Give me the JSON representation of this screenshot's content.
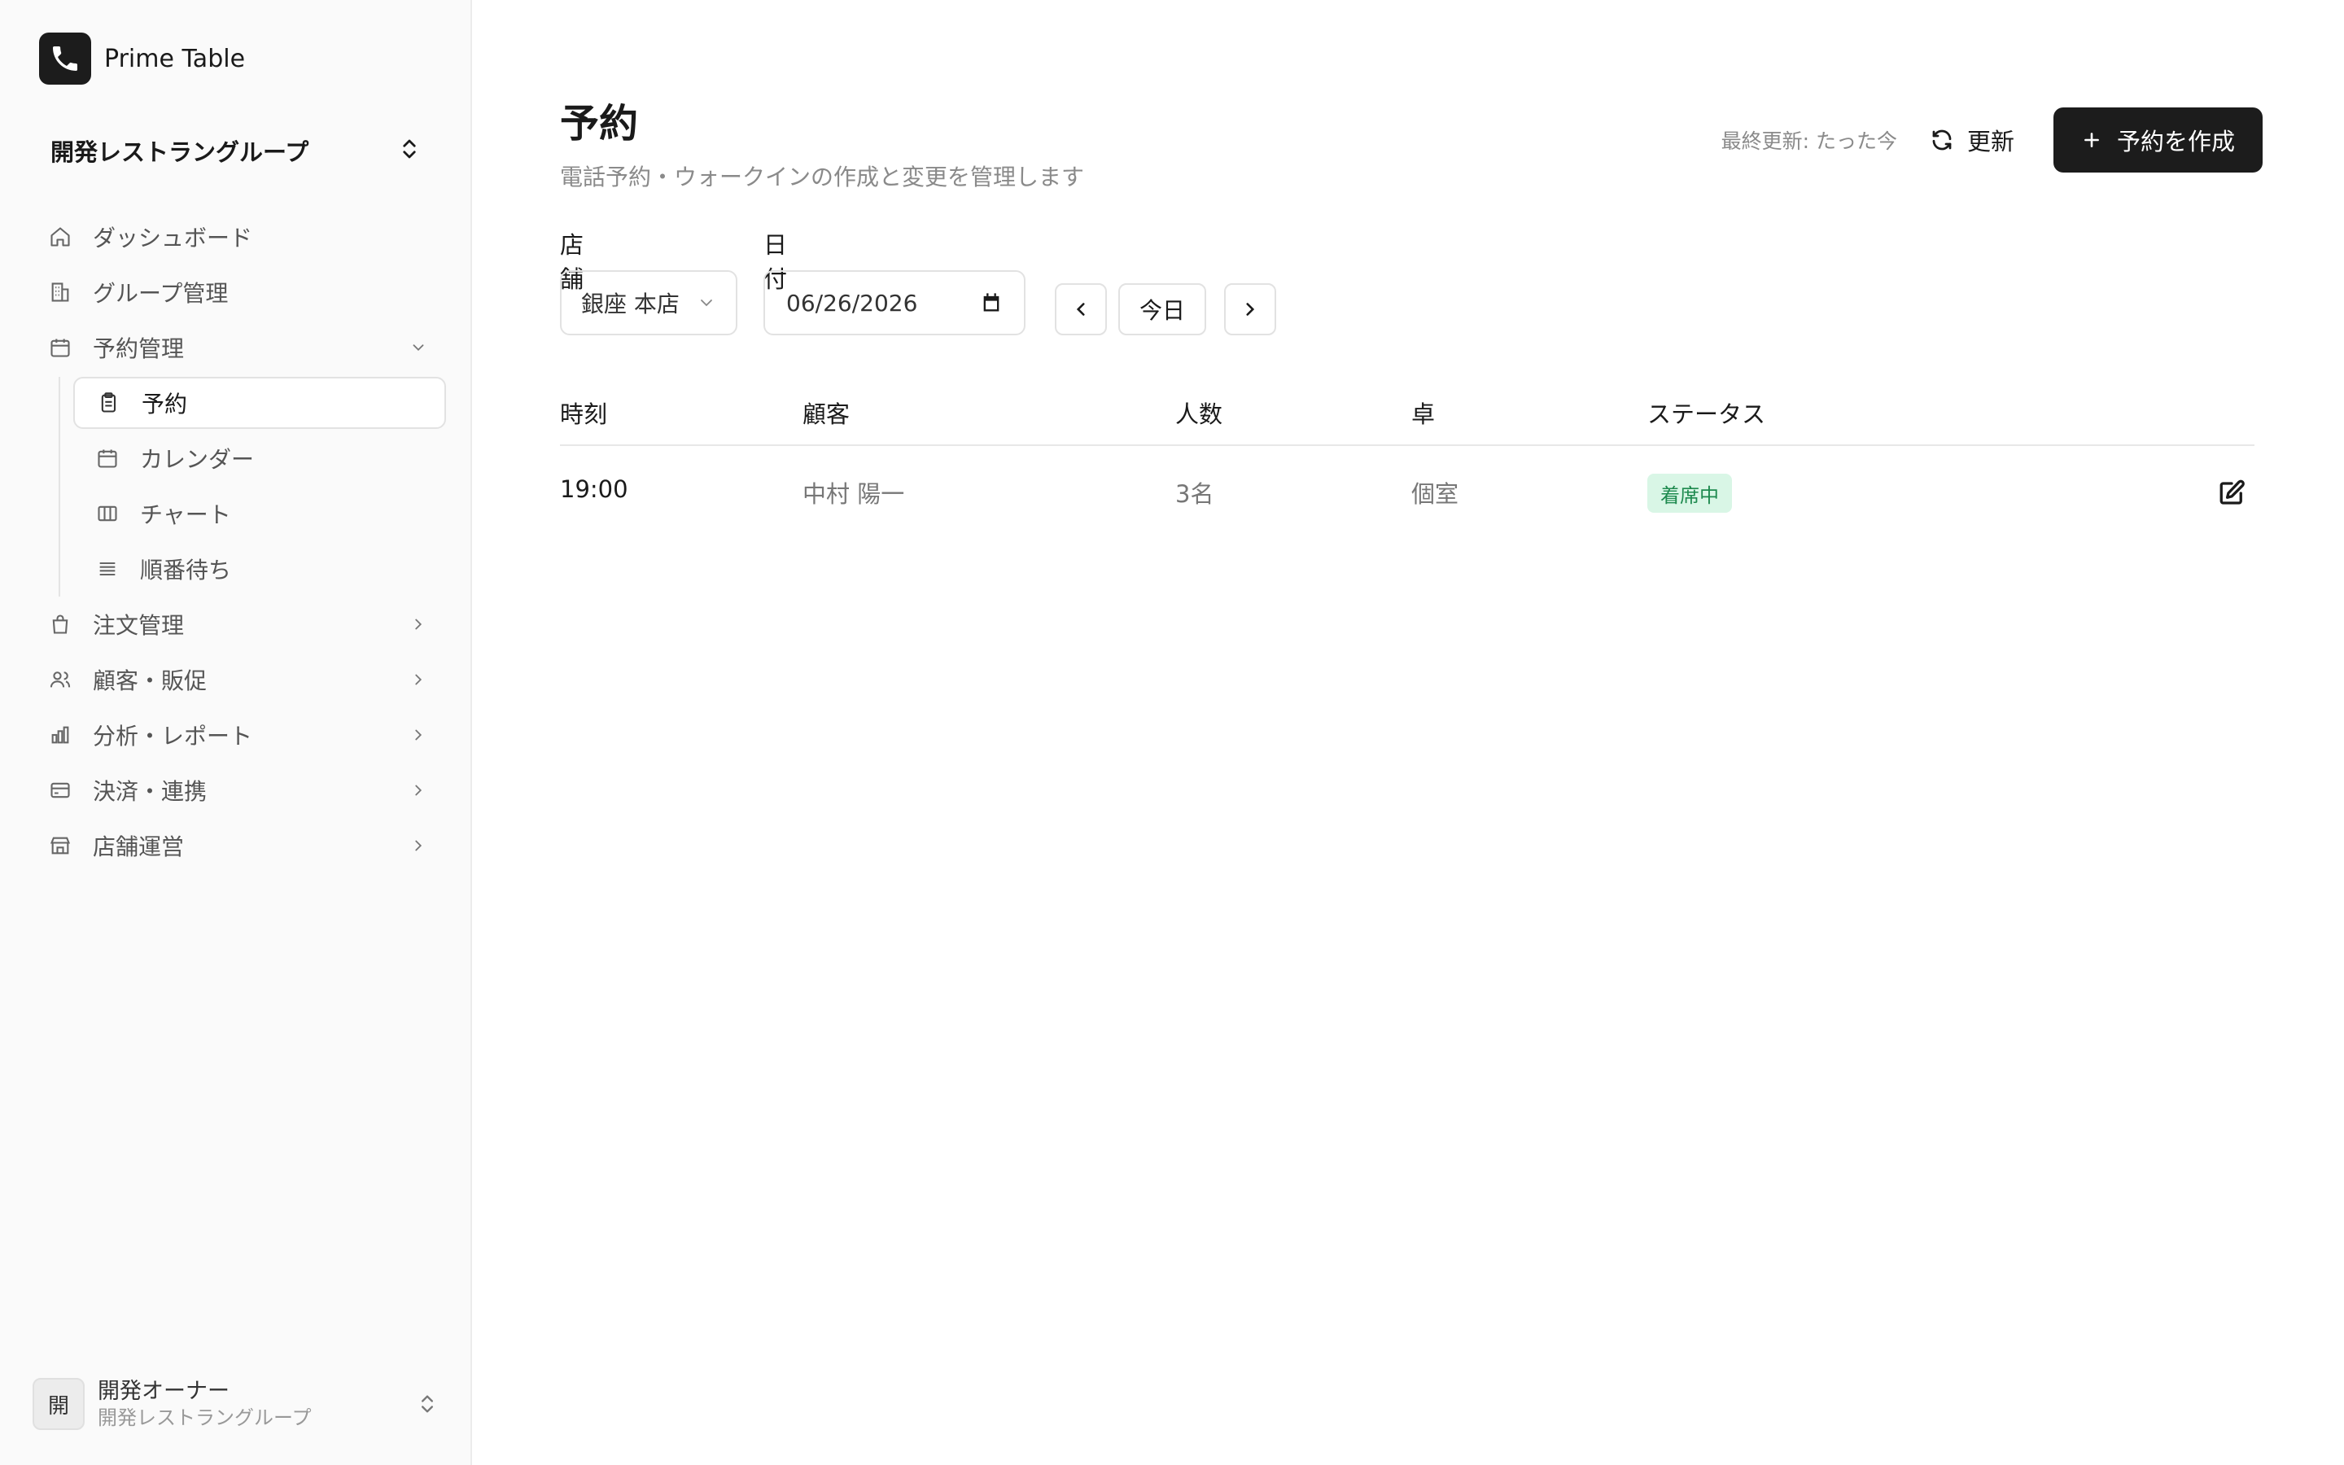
{
  "brand": {
    "name": "Prime Table",
    "icon": "phone-icon"
  },
  "group_switcher": {
    "name": "開発レストラングループ",
    "icon": "chevrons-up-down-icon"
  },
  "sidebar": {
    "items": [
      {
        "label": "ダッシュボード",
        "icon": "home-icon"
      },
      {
        "label": "グループ管理",
        "icon": "building-icon"
      },
      {
        "label": "予約管理",
        "icon": "calendar-icon",
        "expanded": true,
        "children": [
          {
            "label": "予約",
            "icon": "clipboard-icon",
            "active": true
          },
          {
            "label": "カレンダー",
            "icon": "calendar-icon"
          },
          {
            "label": "チャート",
            "icon": "columns-icon"
          },
          {
            "label": "順番待ち",
            "icon": "list-icon"
          }
        ]
      },
      {
        "label": "注文管理",
        "icon": "shopping-bag-icon"
      },
      {
        "label": "顧客・販促",
        "icon": "users-icon"
      },
      {
        "label": "分析・レポート",
        "icon": "bar-chart-icon"
      },
      {
        "label": "決済・連携",
        "icon": "credit-card-icon"
      },
      {
        "label": "店舗運営",
        "icon": "store-icon"
      }
    ]
  },
  "user": {
    "avatar_text": "開",
    "name": "開発オーナー",
    "group": "開発レストラングループ"
  },
  "page": {
    "title": "予約",
    "subtitle": "電話予約・ウォークインの作成と変更を管理します",
    "last_updated": "最終更新: たった今",
    "refresh_label": "更新",
    "create_label": "予約を作成"
  },
  "filters": {
    "store_label": "店舗",
    "store_value": "銀座 本店",
    "date_label": "日付",
    "date_value": "06/26/2026",
    "today_label": "今日"
  },
  "table": {
    "columns": [
      "時刻",
      "顧客",
      "人数",
      "卓",
      "ステータス"
    ],
    "rows": [
      {
        "time": "19:00",
        "customer": "中村 陽一",
        "party": "3名",
        "table": "個室",
        "status": "着席中"
      }
    ]
  },
  "colors": {
    "primary": "#1c1c1c",
    "status_seated_bg": "#d9f6e6",
    "status_seated_text": "#1e8a4f",
    "sidebar_bg": "#fafafa"
  }
}
